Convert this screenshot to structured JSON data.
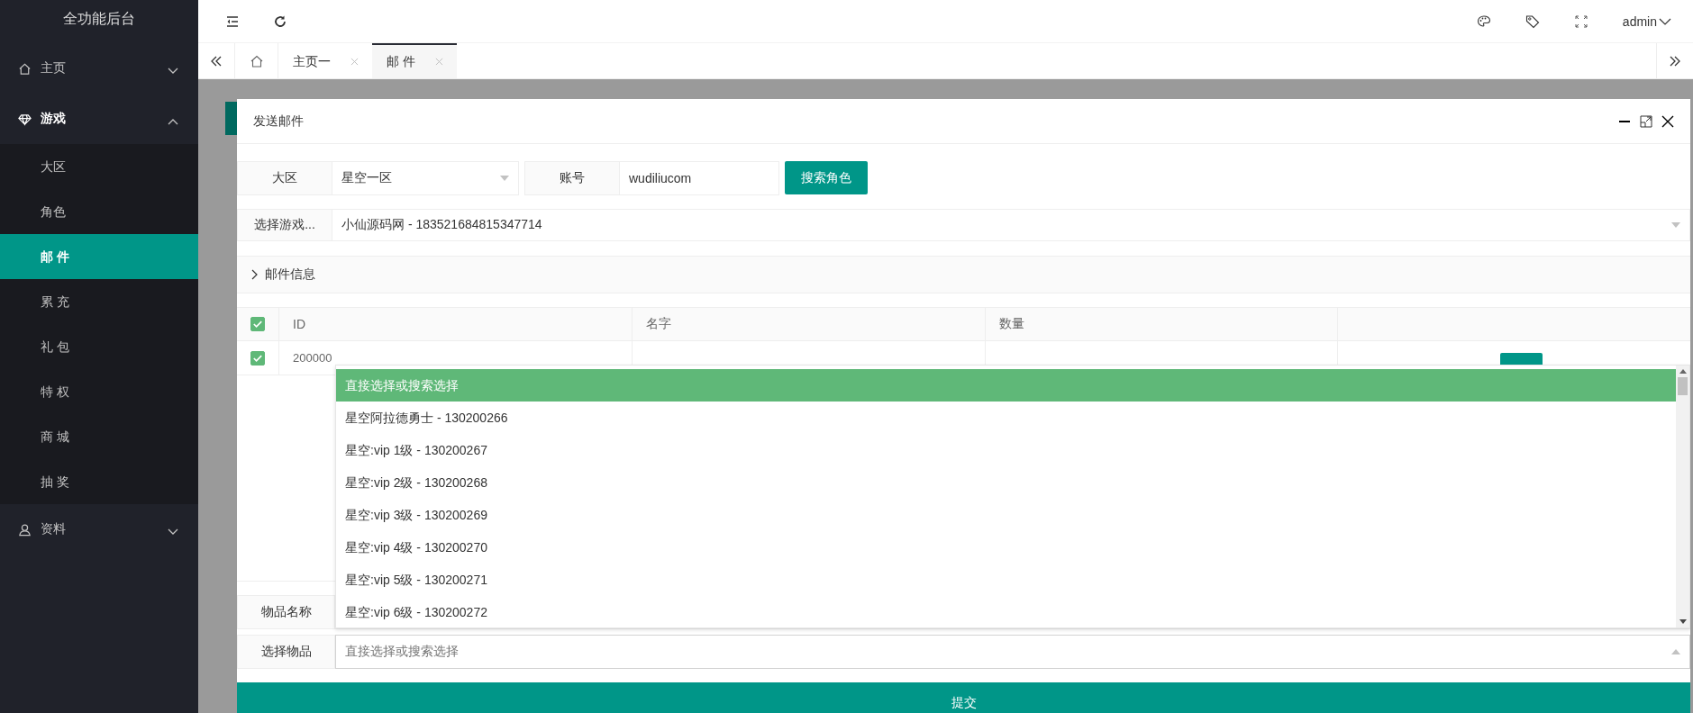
{
  "sidebar": {
    "logo": "全功能后台",
    "menu": [
      {
        "label": "主页",
        "expanded": false
      },
      {
        "label": "游戏",
        "expanded": true,
        "children": [
          {
            "label": "大区",
            "selected": false
          },
          {
            "label": "角色",
            "selected": false
          },
          {
            "label": "邮 件",
            "selected": true
          },
          {
            "label": "累 充",
            "selected": false
          },
          {
            "label": "礼 包",
            "selected": false
          },
          {
            "label": "特 权",
            "selected": false
          },
          {
            "label": "商 城",
            "selected": false
          },
          {
            "label": "抽 奖",
            "selected": false
          }
        ]
      },
      {
        "label": "资料",
        "expanded": false
      }
    ]
  },
  "header": {
    "user": "admin"
  },
  "tabs": [
    {
      "label": "主页一",
      "selected": false
    },
    {
      "label": "邮 件",
      "selected": true
    }
  ],
  "dialog": {
    "title": "发送邮件",
    "region": {
      "label": "大区",
      "value": "星空一区"
    },
    "account": {
      "label": "账号",
      "value": "wudiliucom"
    },
    "search_button": "搜索角色",
    "role": {
      "label": "选择游戏...",
      "value": "小仙源码网 - 183521684815347714"
    },
    "mail_info": {
      "label": "邮件信息",
      "expanded": false
    },
    "table": {
      "columns": [
        "ID",
        "名字",
        "数量"
      ],
      "all_checked": true,
      "rows": [
        {
          "id": "200000",
          "checked": true
        }
      ]
    },
    "item_name": {
      "label": "物品名称"
    },
    "item_select": {
      "label": "选择物品",
      "placeholder": "直接选择或搜索选择",
      "open": true
    },
    "dropdown": {
      "options": [
        {
          "label": "直接选择或搜索选择",
          "selected": true
        },
        {
          "label": "星空阿拉德勇士 - 130200266",
          "selected": false
        },
        {
          "label": "星空:vip 1级 - 130200267",
          "selected": false
        },
        {
          "label": "星空:vip 2级 - 130200268",
          "selected": false
        },
        {
          "label": "星空:vip 3级 - 130200269",
          "selected": false
        },
        {
          "label": "星空:vip 4级 - 130200270",
          "selected": false
        },
        {
          "label": "星空:vip 5级 - 130200271",
          "selected": false
        },
        {
          "label": "星空:vip 6级 - 130200272",
          "selected": false
        }
      ]
    },
    "submit": "提交"
  }
}
